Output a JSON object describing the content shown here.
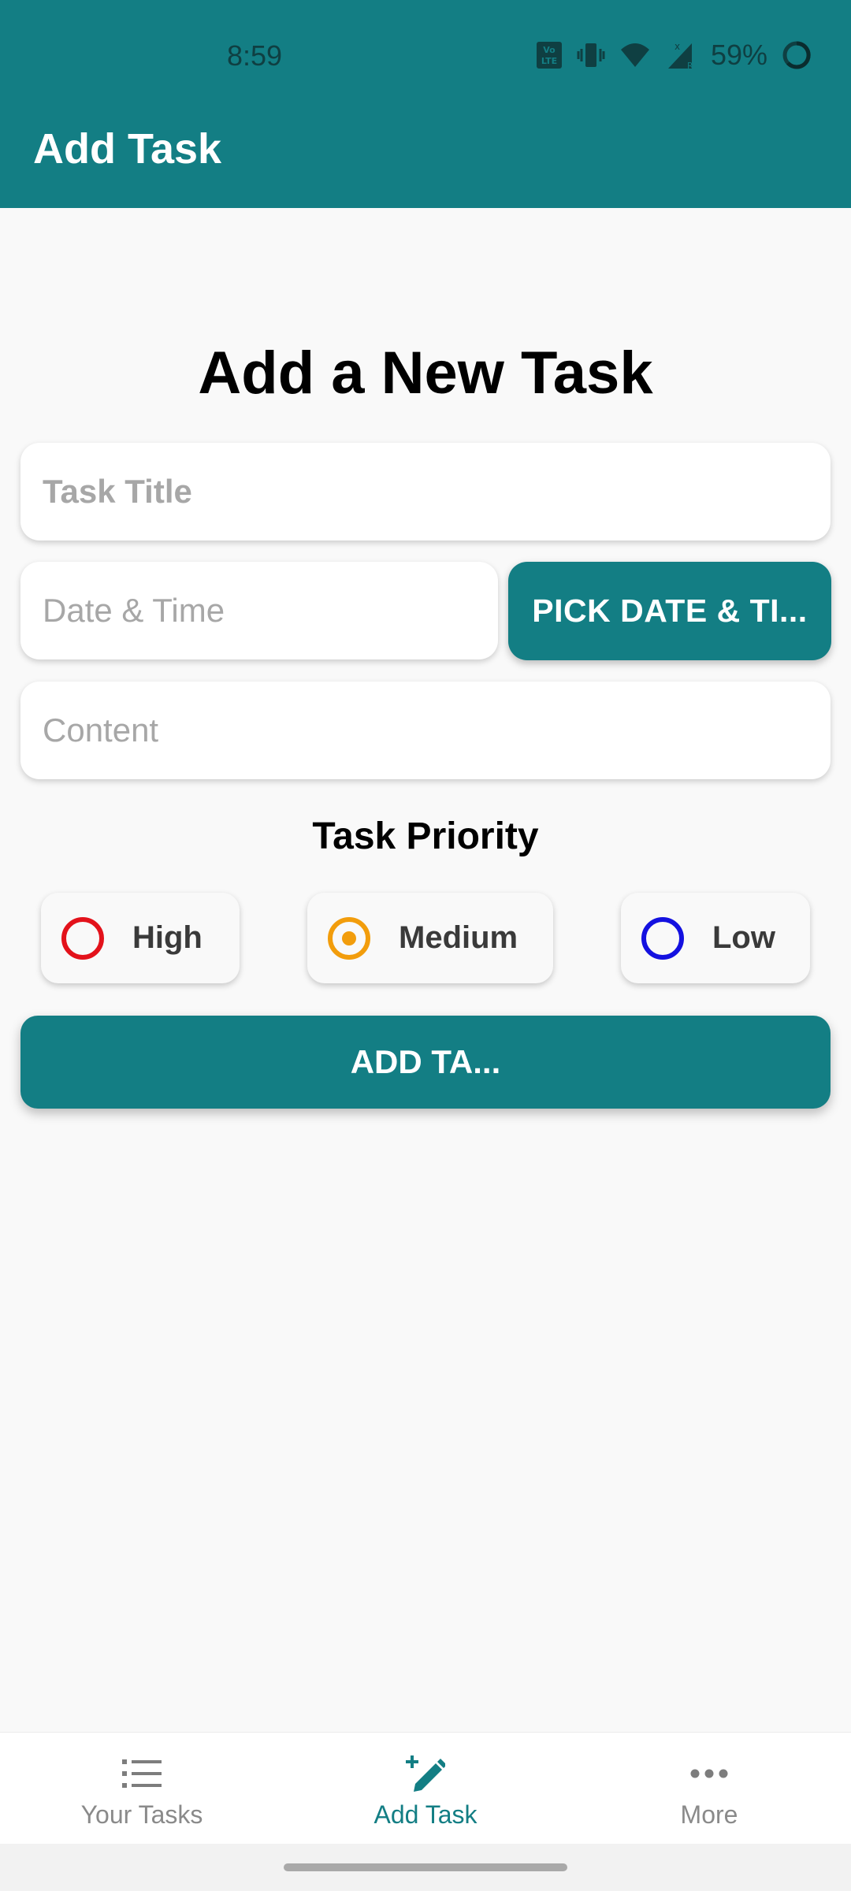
{
  "status_bar": {
    "time": "8:59",
    "battery": "59%",
    "icons": [
      "volte-icon",
      "vibrate-icon",
      "wifi-icon",
      "signal-icon",
      "battery-ring-icon"
    ]
  },
  "app_bar": {
    "title": "Add Task"
  },
  "form": {
    "heading": "Add a New Task",
    "title_placeholder": "Task Title",
    "datetime_placeholder": "Date & Time",
    "pick_datetime_label": "PICK DATE & TI...",
    "content_placeholder": "Content",
    "priority_heading": "Task Priority",
    "priorities": [
      {
        "label": "High",
        "color": "#e3121b",
        "selected": false
      },
      {
        "label": "Medium",
        "color": "#f29d0c",
        "selected": true
      },
      {
        "label": "Low",
        "color": "#1411e0",
        "selected": false
      }
    ],
    "add_button_label": "ADD TA..."
  },
  "bottom_nav": {
    "items": [
      {
        "label": "Your Tasks",
        "icon": "list-icon",
        "active": false
      },
      {
        "label": "Add Task",
        "icon": "add-edit-icon",
        "active": true
      },
      {
        "label": "More",
        "icon": "more-horiz-icon",
        "active": false
      }
    ]
  },
  "colors": {
    "primary": "#137e84",
    "background": "#f9f9f9"
  }
}
